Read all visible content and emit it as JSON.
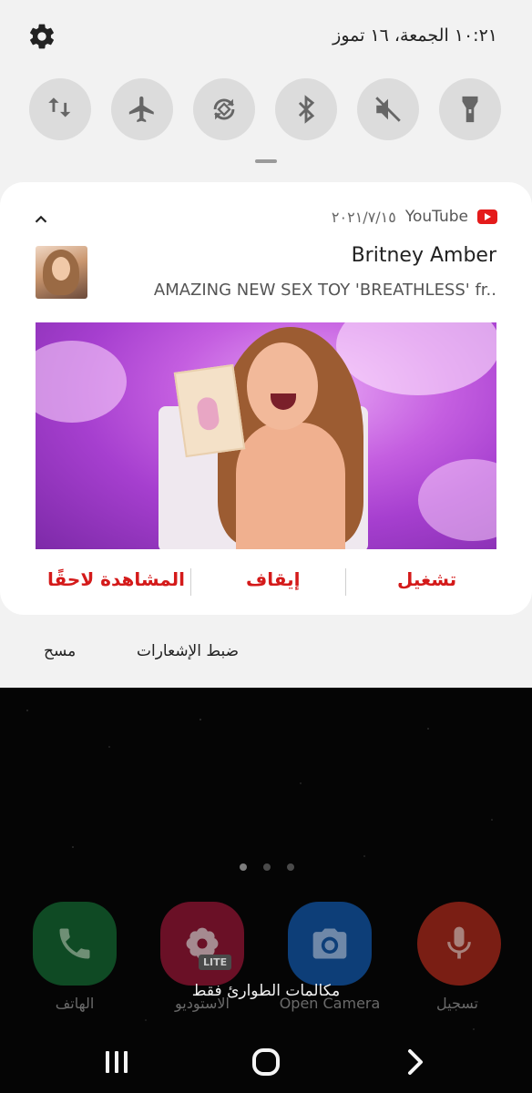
{
  "status": {
    "datetime": "١٠:٢١ الجمعة، ١٦ تموز"
  },
  "quick_settings": [
    {
      "icon": "mobile-data-icon",
      "label": "Mobile data"
    },
    {
      "icon": "airplane-mode-icon",
      "label": "Airplane mode"
    },
    {
      "icon": "auto-rotate-icon",
      "label": "Auto rotate"
    },
    {
      "icon": "bluetooth-icon",
      "label": "Bluetooth"
    },
    {
      "icon": "mute-icon",
      "label": "Mute"
    },
    {
      "icon": "flashlight-icon",
      "label": "Flashlight"
    }
  ],
  "notification": {
    "app_name": "YouTube",
    "date": "٢٠٢١/٧/١٥",
    "title": "Britney Amber",
    "subtitle": "AMAZING NEW SEX TOY 'BREATHLESS' fr..",
    "actions": {
      "play": "تشغيل",
      "stop": "إيقاف",
      "watch_later": "المشاهدة لاحقًا"
    },
    "footer": {
      "settings": "ضبط الإشعارات",
      "clear": "مسح"
    }
  },
  "home": {
    "page_dots": 3,
    "active_dot": 0,
    "apps": [
      {
        "label": "الهاتف",
        "icon": "phone-icon",
        "color": "#0f4a24"
      },
      {
        "label": "الاستوديو",
        "icon": "gallery-icon",
        "color": "#6a1026",
        "badge": "LITE"
      },
      {
        "label": "Open Camera",
        "icon": "camera-icon",
        "color": "#0d3e78"
      },
      {
        "label": "تسجيل",
        "icon": "microphone-icon",
        "color": "#7a1e14"
      }
    ],
    "emergency_text": "مكالمات الطوارئ فقط"
  },
  "navbar": {
    "recents": "recents-icon",
    "home": "home-icon",
    "back": "back-icon"
  },
  "colors": {
    "accent": "#d41a1a",
    "panel_bg": "#f2f2f2",
    "toggle_bg": "#dcdcdc"
  }
}
